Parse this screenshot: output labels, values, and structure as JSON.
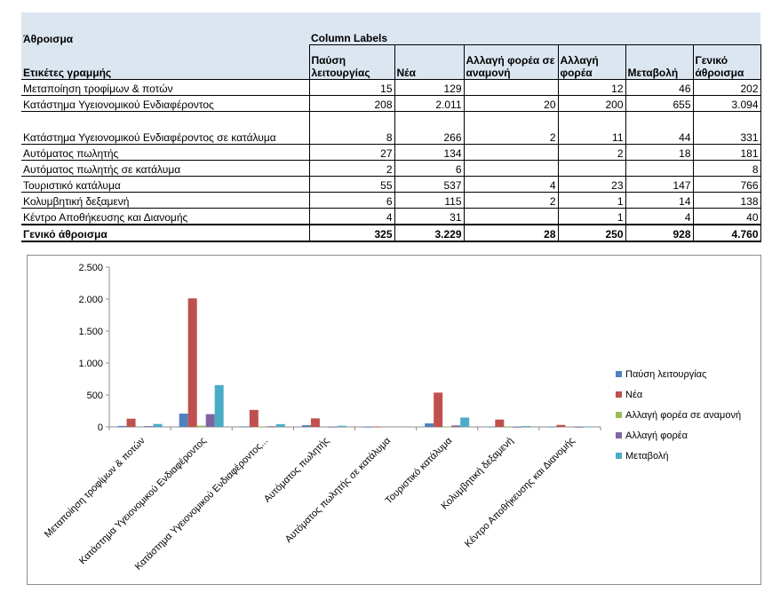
{
  "pivot": {
    "values_label": "Άθροισμα",
    "column_labels_caption": "Column Labels",
    "row_labels_header": "Ετικέτες γραμμής",
    "columns": [
      "Παύση λειτουργίας",
      "Νέα",
      "Αλλαγή φορέα σε αναμονή",
      "Αλλαγή φορέα",
      "Μεταβολή",
      "Γενικό άθροισμα"
    ],
    "rows": [
      {
        "label": "Μεταποίηση τροφίμων & ποτών",
        "cells": [
          "15",
          "129",
          "",
          "12",
          "46",
          "202"
        ]
      },
      {
        "label": "Κατάστημα Υγειονομικού Ενδιαφέροντος",
        "cells": [
          "208",
          "2.011",
          "20",
          "200",
          "655",
          "3.094"
        ]
      },
      {
        "label": "Κατάστημα Υγειονομικού Ενδιαφέροντος σε κατάλυμα",
        "cells": [
          "8",
          "266",
          "2",
          "11",
          "44",
          "331"
        ]
      },
      {
        "label": "Αυτόματος πωλητής",
        "cells": [
          "27",
          "134",
          "",
          "2",
          "18",
          "181"
        ]
      },
      {
        "label": "Αυτόματος πωλητής σε κατάλυμα",
        "cells": [
          "2",
          "6",
          "",
          "",
          "",
          "8"
        ]
      },
      {
        "label": "Τουριστικό κατάλυμα",
        "cells": [
          "55",
          "537",
          "4",
          "23",
          "147",
          "766"
        ]
      },
      {
        "label": "Κολυμβητική δεξαμενή",
        "cells": [
          "6",
          "115",
          "2",
          "1",
          "14",
          "138"
        ]
      },
      {
        "label": "Κέντρο Αποθήκευσης και Διανομής",
        "cells": [
          "4",
          "31",
          "",
          "1",
          "4",
          "40"
        ]
      }
    ],
    "total": {
      "label": "Γενικό άθροισμα",
      "cells": [
        "325",
        "3.229",
        "28",
        "250",
        "928",
        "4.760"
      ]
    }
  },
  "chart_data": {
    "type": "bar",
    "categories": [
      "Μεταποίηση τροφίμων & ποτών",
      "Κατάστημα Υγειονομικού Ενδιαφέροντος",
      "Κατάστημα Υγειονομικού Ενδιαφέροντος...",
      "Αυτόματος πωλητής",
      "Αυτόματος πωλητής σε κατάλυμα",
      "Τουριστικό κατάλυμα",
      "Κολυμβητική δεξαμενή",
      "Κέντρο Αποθήκευσης και Διανομής"
    ],
    "series": [
      {
        "name": "Παύση λειτουργίας",
        "color": "#4f81bd",
        "values": [
          15,
          208,
          8,
          27,
          2,
          55,
          6,
          4
        ]
      },
      {
        "name": "Νέα",
        "color": "#c0504d",
        "values": [
          129,
          2011,
          266,
          134,
          6,
          537,
          115,
          31
        ]
      },
      {
        "name": "Αλλαγή φορέα σε αναμονή",
        "color": "#9bbb59",
        "values": [
          0,
          20,
          2,
          0,
          0,
          4,
          2,
          0
        ]
      },
      {
        "name": "Αλλαγή φορέα",
        "color": "#8064a2",
        "values": [
          12,
          200,
          11,
          2,
          0,
          23,
          1,
          1
        ]
      },
      {
        "name": "Μεταβολή",
        "color": "#4bacc6",
        "values": [
          46,
          655,
          44,
          18,
          0,
          147,
          14,
          4
        ]
      }
    ],
    "ylim": [
      0,
      2500
    ],
    "yticks": [
      "0",
      "500",
      "1.000",
      "1.500",
      "2.000",
      "2.500"
    ],
    "ytick_values": [
      0,
      500,
      1000,
      1500,
      2000,
      2500
    ],
    "grid": false,
    "legend": "right"
  }
}
